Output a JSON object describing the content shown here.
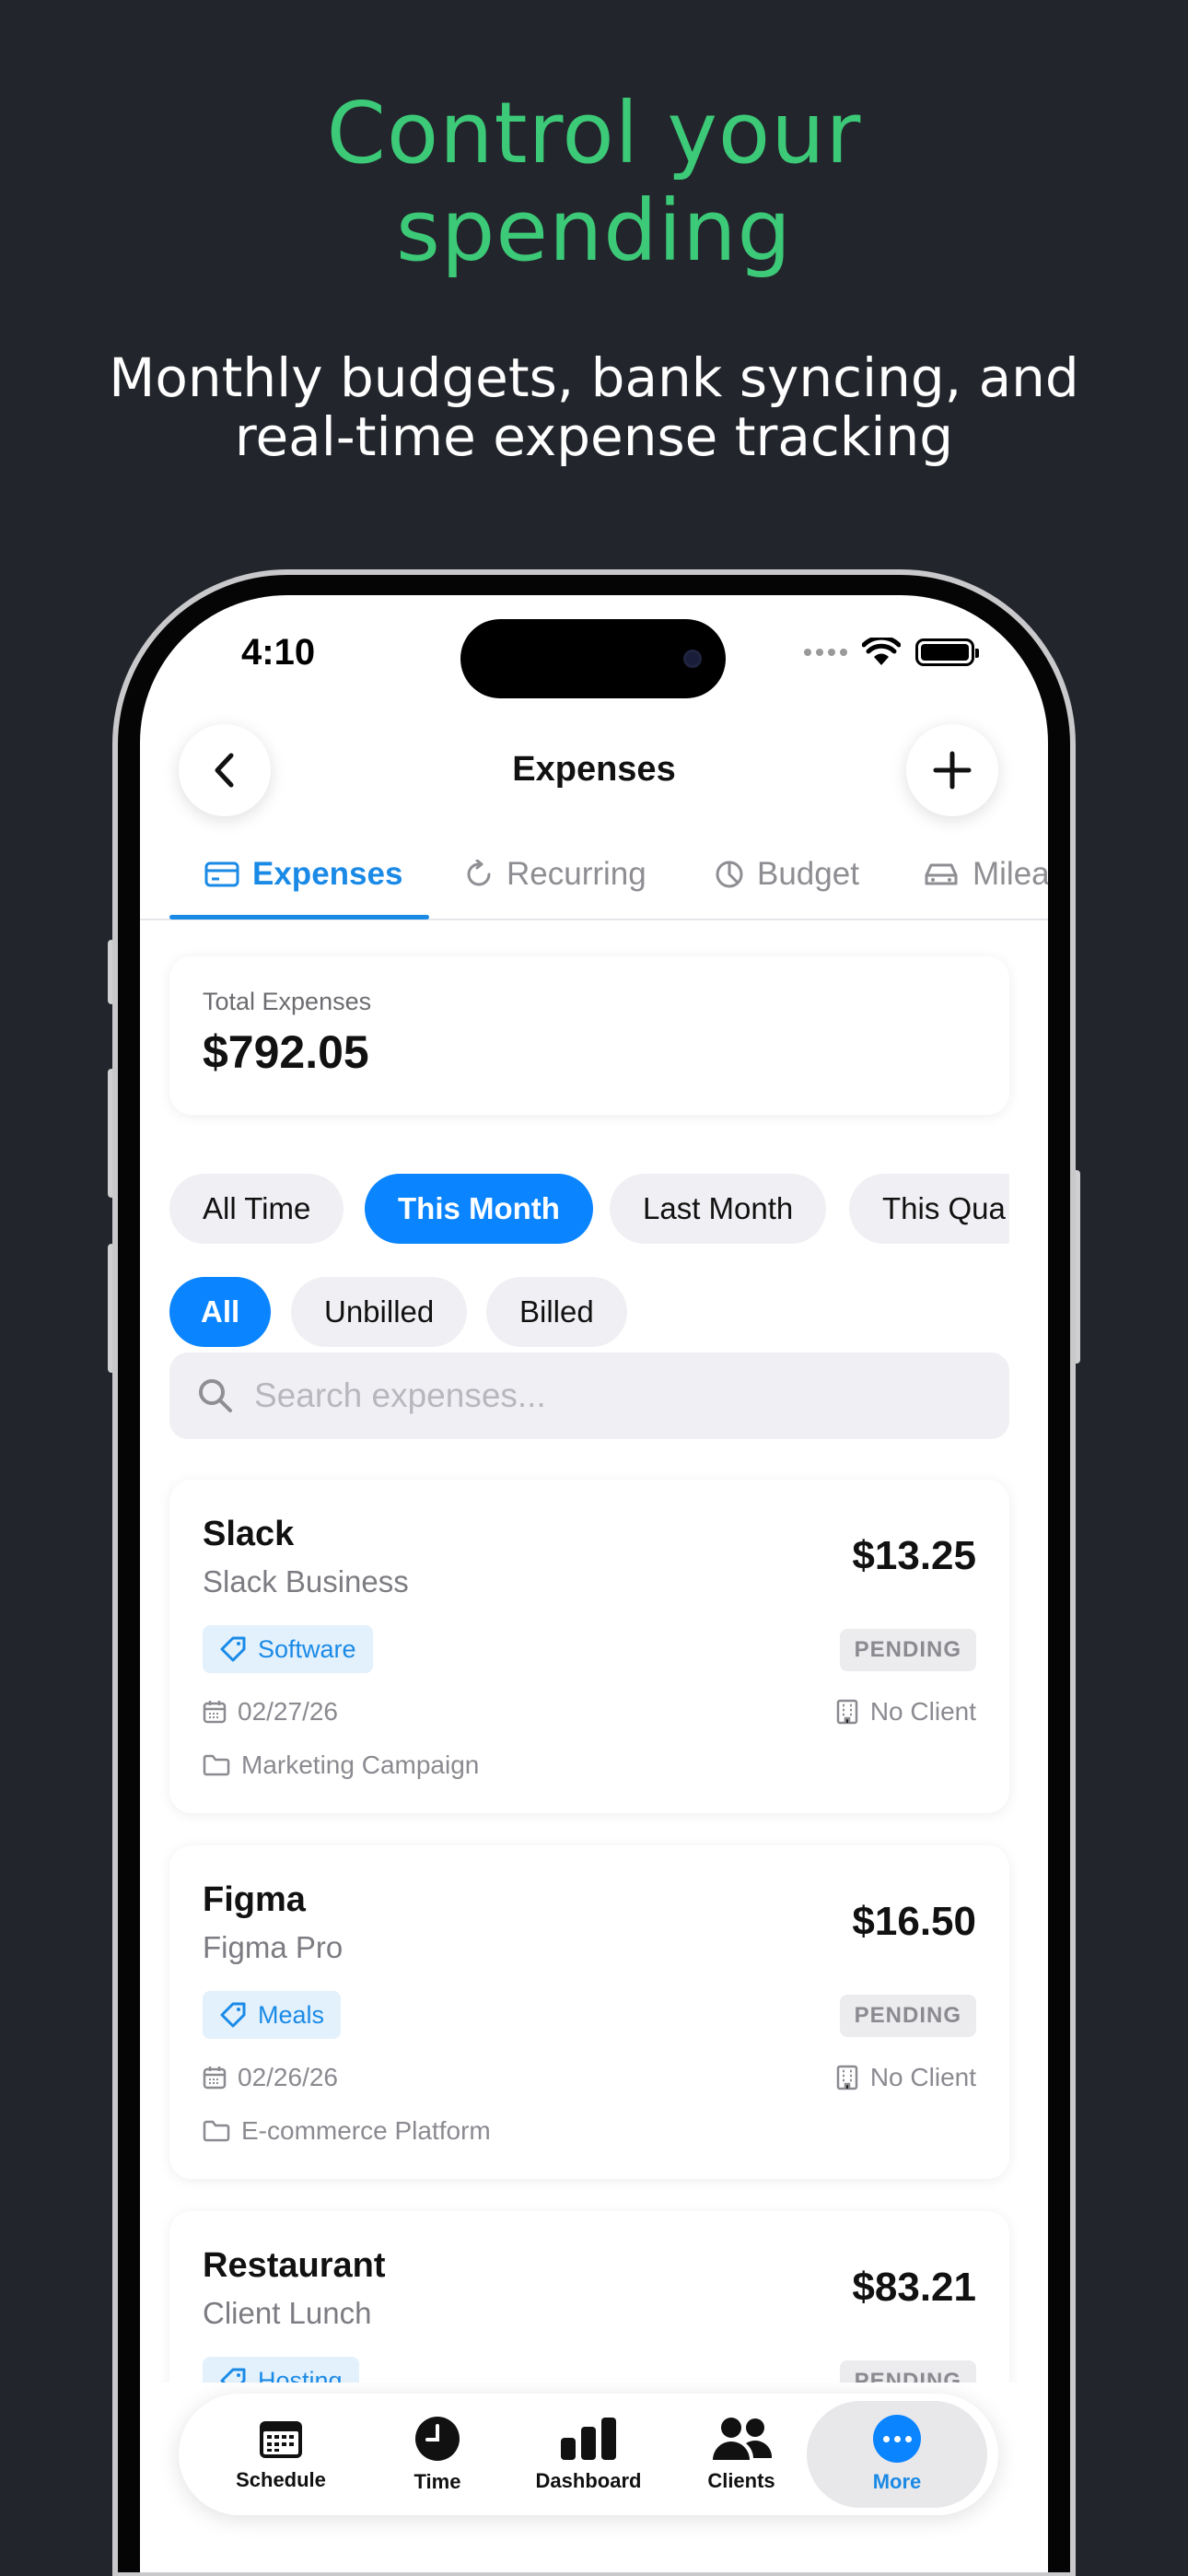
{
  "promo": {
    "headline": "Control your spending",
    "subline": "Monthly budgets, bank syncing, and real-time expense tracking"
  },
  "status_bar": {
    "time": "4:10"
  },
  "nav": {
    "title": "Expenses",
    "back_icon": "chevron-left-icon",
    "add_icon": "plus-icon"
  },
  "tabs": [
    {
      "label": "Expenses",
      "icon": "card-icon",
      "active": true
    },
    {
      "label": "Recurring",
      "icon": "refresh-icon",
      "active": false
    },
    {
      "label": "Budget",
      "icon": "pie-icon",
      "active": false
    },
    {
      "label": "Milea",
      "icon": "car-icon",
      "active": false
    }
  ],
  "total": {
    "label": "Total Expenses",
    "value": "$792.05"
  },
  "period_filters": [
    {
      "label": "All Time",
      "selected": false
    },
    {
      "label": "This Month",
      "selected": true
    },
    {
      "label": "Last Month",
      "selected": false
    },
    {
      "label": "This Qua",
      "selected": false
    }
  ],
  "billing_filters": [
    {
      "label": "All",
      "selected": true
    },
    {
      "label": "Unbilled",
      "selected": false
    },
    {
      "label": "Billed",
      "selected": false
    }
  ],
  "search": {
    "placeholder": "Search expenses..."
  },
  "expenses": [
    {
      "name": "Slack",
      "vendor": "Slack Business",
      "amount": "$13.25",
      "category": "Software",
      "status": "PENDING",
      "date": "02/27/26",
      "client": "No Client",
      "project": "Marketing Campaign"
    },
    {
      "name": "Figma",
      "vendor": "Figma Pro",
      "amount": "$16.50",
      "category": "Meals",
      "status": "PENDING",
      "date": "02/26/26",
      "client": "No Client",
      "project": "E-commerce Platform"
    },
    {
      "name": "Restaurant",
      "vendor": "Client Lunch",
      "amount": "$83.21",
      "category": "Hosting",
      "status": "PENDING",
      "date": "",
      "client": "",
      "project": ""
    }
  ],
  "tabbar": [
    {
      "label": "Schedule",
      "icon": "calendar-icon",
      "active": false
    },
    {
      "label": "Time",
      "icon": "clock-icon",
      "active": false
    },
    {
      "label": "Dashboard",
      "icon": "bar-chart-icon",
      "active": false
    },
    {
      "label": "Clients",
      "icon": "people-icon",
      "active": false
    },
    {
      "label": "More",
      "icon": "more-icon",
      "active": true
    }
  ],
  "colors": {
    "background": "#22252b",
    "headline": "#3cc978",
    "accent": "#0a84ff",
    "tab_active": "#1a8ae6"
  }
}
